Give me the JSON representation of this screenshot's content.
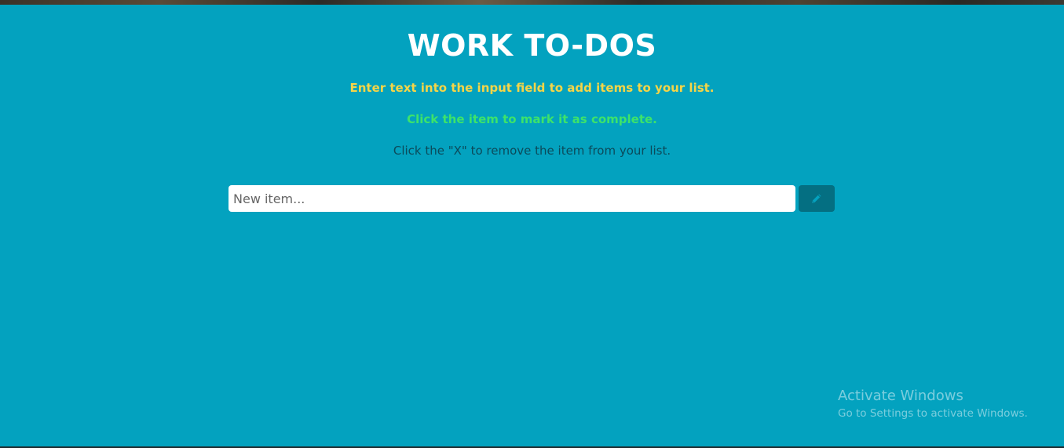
{
  "page": {
    "title": "WORK TO-DOS",
    "instructions": [
      "Enter text into the input field to add items to your list.",
      "Click the item to mark it as complete.",
      "Click the \"X\" to remove the item from your list."
    ]
  },
  "form": {
    "input_placeholder": "New item...",
    "input_value": "",
    "add_button_icon": "pencil-icon"
  },
  "watermark": {
    "title": "Activate Windows",
    "subtitle": "Go to Settings to activate Windows."
  },
  "colors": {
    "background": "#03a2bf",
    "title": "#ffffff",
    "instruction_add": "#f5d547",
    "instruction_complete": "#3de36a",
    "instruction_remove": "#0c4a5a",
    "button": "#046f82",
    "button_icon": "#03a2bf"
  }
}
